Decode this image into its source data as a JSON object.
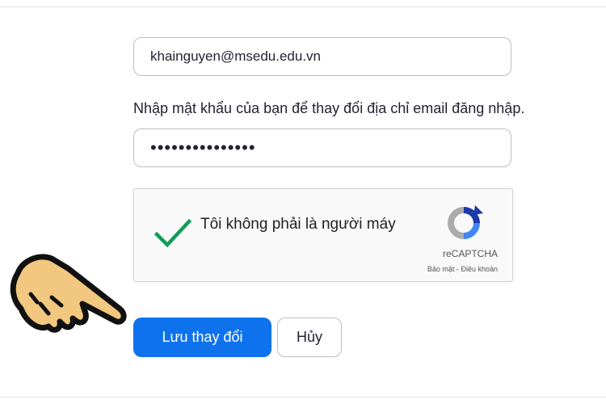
{
  "form": {
    "email_value": "khainguyen@msedu.edu.vn",
    "instruction": "Nhập mật khẩu của bạn để thay đổi địa chỉ email đăng nhập.",
    "password_value": "•••••••••••••••"
  },
  "recaptcha": {
    "label": "Tôi không phải là người máy",
    "brand": "reCAPTCHA",
    "privacy_link": "Bảo mật",
    "separator": " - ",
    "terms_link": "Điều khoản",
    "check_color": "#0f9d58"
  },
  "actions": {
    "save_label": "Lưu thay đổi",
    "cancel_label": "Hủy"
  },
  "colors": {
    "primary": "#0e72ed",
    "border": "#bdbdc6",
    "text": "#232333"
  },
  "overlay": {
    "icon": "pointing-hand-icon"
  }
}
